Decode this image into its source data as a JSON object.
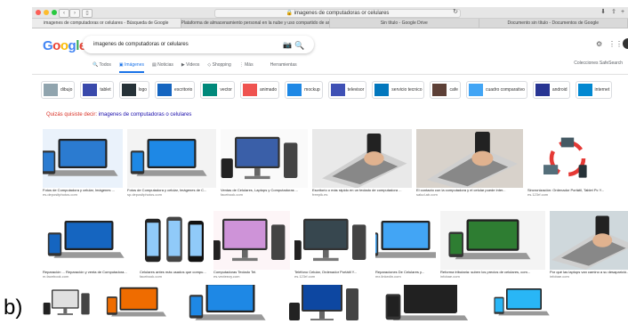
{
  "corner_label": "b)",
  "browser": {
    "url": "imagenes de computadoras or celulares",
    "tabs": [
      "imagenes de computadoras or celulares - Búsqueda de Google",
      "Plataforma de almacenamiento personal en la nube y uso compartido de archivo...",
      "Sin título - Google Drive",
      "Documento sin título - Documentos de Google"
    ]
  },
  "google": {
    "logo": "Google",
    "query": "imagenes de computadoras or celulares",
    "nav_tabs": [
      "Todos",
      "Imágenes",
      "Noticias",
      "Videos",
      "Shopping",
      "Más",
      "Herramientas"
    ],
    "right_links": "Colecciones   SafeSearch",
    "chips": [
      "dibujo",
      "tablet",
      "logo",
      "escritorio",
      "vector",
      "animado",
      "mockup",
      "televisor",
      "servicio tecnico",
      "cafe",
      "cuadro comparativo",
      "android",
      "internet"
    ],
    "suggestion_prefix": "Quizás quisiste decir:",
    "suggestion_link": "imagenes de computadoras o celulares",
    "row1": [
      {
        "caption": "Fotos de Computadora y celular, Imágenes ...",
        "source": "es.depositphotos.com"
      },
      {
        "caption": "Fotos de Computadora y celular, Imágenes de C...",
        "source": "sp.depositphotos.com"
      },
      {
        "caption": "Ventas de Celulares, Laptops y Computadoras ...",
        "source": "facebook.com"
      },
      {
        "caption": "Escritorio o más rápido en un teclado de computadora ...",
        "source": "freepik.es"
      },
      {
        "caption": "El contacto con la computadora y el celular puede inter...",
        "source": "salud.ab.com"
      },
      {
        "caption": "Sincronización: Ordenador Portátil, Tablet Pc Y...",
        "source": "es.123rf.com"
      }
    ],
    "row2": [
      {
        "caption": "Reparación ... Reparación y venta de Computadora...",
        "source": "m.facebook.com"
      },
      {
        "caption": "Celulares antes más usados que compu...",
        "source": "facebook.com"
      },
      {
        "caption": "Computadoras Teclado Tel.",
        "source": "es.vecteezy.com"
      },
      {
        "caption": "Teléfono Celular, Ordenador Portátil Y...",
        "source": "es.123rf.com"
      },
      {
        "caption": "Reparaciones De Celulares y...",
        "source": "mx.linkedin.com"
      },
      {
        "caption": "Reforma tributaria: suben los precios de celulares, com...",
        "source": "infobae.com"
      },
      {
        "caption": "Por qué las laptops van camino a su desaparició...",
        "source": "infobae.com"
      }
    ],
    "colors": {
      "blue": "#4285f4",
      "red": "#ea4335",
      "yellow": "#fbbc05",
      "green": "#34a853"
    }
  }
}
